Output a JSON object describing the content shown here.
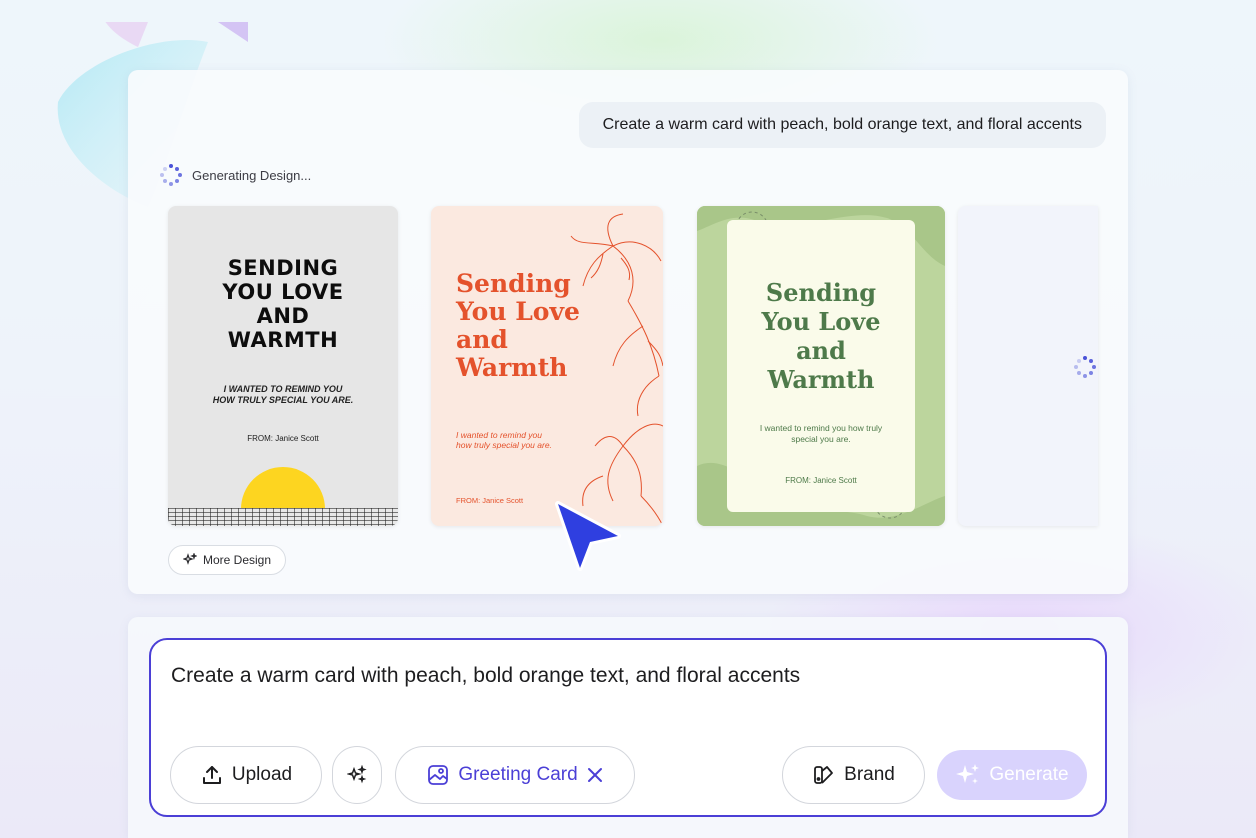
{
  "chat": {
    "prompt": "Create a warm card with peach, bold orange text, and floral accents",
    "status": "Generating Design..."
  },
  "designs": [
    {
      "title_lines": [
        "SENDING",
        "YOU LOVE",
        "AND",
        "WARMTH"
      ],
      "sub_lines": [
        "I WANTED TO REMIND YOU",
        "HOW TRULY SPECIAL YOU ARE."
      ],
      "from": "FROM: Janice Scott"
    },
    {
      "title_lines": [
        "Sending",
        "You Love",
        "and",
        "Warmth"
      ],
      "sub_lines": [
        "I wanted to remind you",
        "how truly special you are."
      ],
      "from": "FROM: Janice Scott"
    },
    {
      "title_lines": [
        "Sending",
        "You Love",
        "and",
        "Warmth"
      ],
      "sub_lines": [
        "I wanted to remind you  how truly",
        "special you are."
      ],
      "from": "FROM: Janice Scott"
    }
  ],
  "more_design_label": "More Design",
  "composer": {
    "text": "Create a warm card with peach, bold orange text, and floral accents",
    "upload_label": "Upload",
    "tag_label": "Greeting Card",
    "brand_label": "Brand",
    "generate_label": "Generate"
  },
  "colors": {
    "accent": "#4b3fd6",
    "card1_sun": "#fdd520",
    "card2_text": "#e4522c",
    "card2_bg": "#fbe9e0",
    "card3_text": "#4e7a4a",
    "card3_bg": "#bcd59d",
    "generate_bg": "#d9d3fd"
  },
  "icons": [
    "loading-spinner-icon",
    "sparkle-icon",
    "upload-icon",
    "magic-wand-icon",
    "greeting-card-icon",
    "close-icon",
    "brand-palette-icon",
    "pointer-cursor-icon"
  ]
}
